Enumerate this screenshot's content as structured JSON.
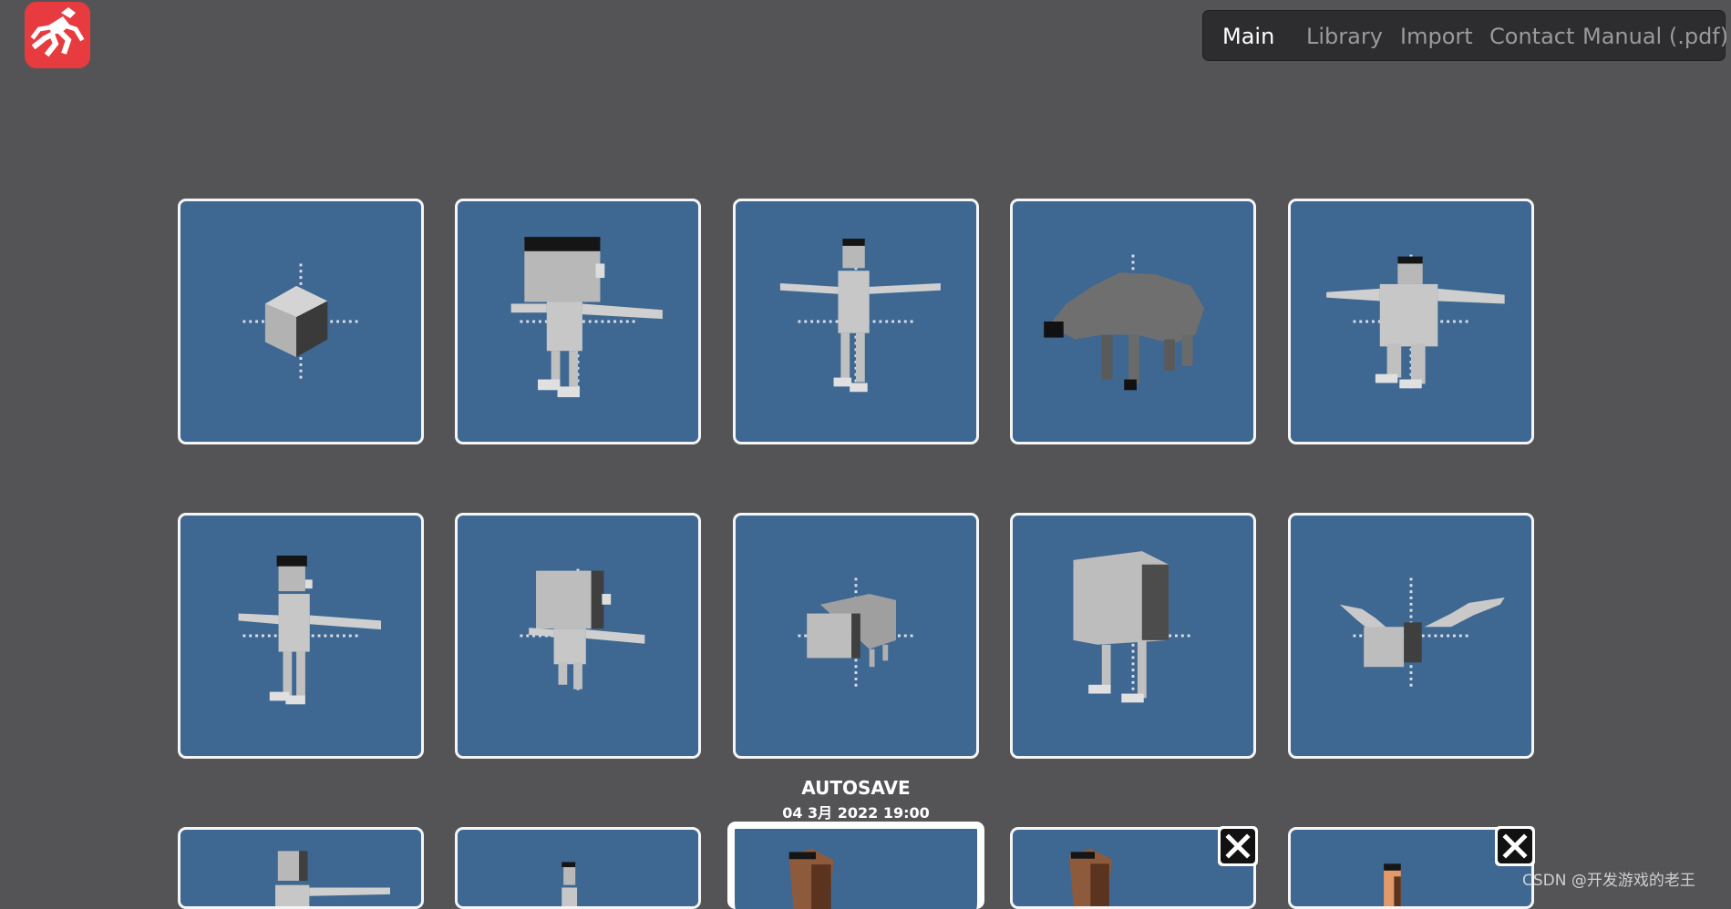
{
  "app": {
    "logo_icon": "running-figure-icon",
    "logo_color": "#e73b3f"
  },
  "nav": {
    "items": [
      {
        "label": "Main",
        "active": true
      },
      {
        "label": "Library",
        "active": false
      },
      {
        "label": "Import",
        "active": false
      },
      {
        "label": "Contact",
        "active": false
      },
      {
        "label": "Manual (.pdf)",
        "active": false
      }
    ]
  },
  "gallery": {
    "tile_color": "#3e6791",
    "tiles": [
      {
        "thumbnail": "cube-model"
      },
      {
        "thumbnail": "big-head-character-model"
      },
      {
        "thumbnail": "tall-humanoid-model"
      },
      {
        "thumbnail": "quadruped-animal-model"
      },
      {
        "thumbnail": "bulky-humanoid-model"
      },
      {
        "thumbnail": "humanoid-model"
      },
      {
        "thumbnail": "box-head-character-model"
      },
      {
        "thumbnail": "small-creature-model"
      },
      {
        "thumbnail": "box-body-two-legs-model"
      },
      {
        "thumbnail": "winged-creature-model"
      },
      {
        "thumbnail": "humanoid-model"
      },
      {
        "thumbnail": "humanoid-model"
      },
      {
        "thumbnail": "brown-character-model"
      },
      {
        "thumbnail": "brown-character-model"
      },
      {
        "thumbnail": "orange-character-model"
      }
    ],
    "delete_icon": "close-icon"
  },
  "autosave": {
    "title": "AUTOSAVE",
    "date": "04 3月 2022 19:00"
  },
  "watermark": "CSDN @开发游戏的老王"
}
